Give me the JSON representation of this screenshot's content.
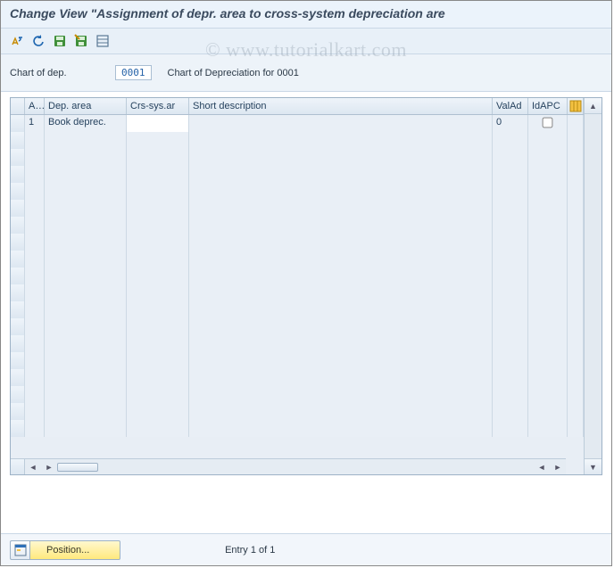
{
  "title": "Change View \"Assignment of depr. area to cross-system depreciation are",
  "toolbar": {
    "icons": [
      "other-view-icon",
      "undo-icon",
      "save-icon",
      "save-variant-icon",
      "select-all-icon"
    ]
  },
  "header": {
    "label": "Chart of dep.",
    "value": "0001",
    "description": "Chart of Depreciation for 0001"
  },
  "table": {
    "columns": {
      "ar": "Ar.",
      "deparea": "Dep. area",
      "crssys": "Crs-sys.ar",
      "short": "Short description",
      "valad": "ValAd",
      "idapc": "IdAPC"
    },
    "rows": [
      {
        "ar": "1",
        "deparea": "Book deprec.",
        "crssys": "",
        "short": "",
        "valad": "0",
        "idapc": false
      }
    ],
    "empty_rows": 18
  },
  "footer": {
    "position_label": "Position...",
    "entry_text": "Entry 1 of 1"
  },
  "watermark": "© www.tutorialkart.com"
}
